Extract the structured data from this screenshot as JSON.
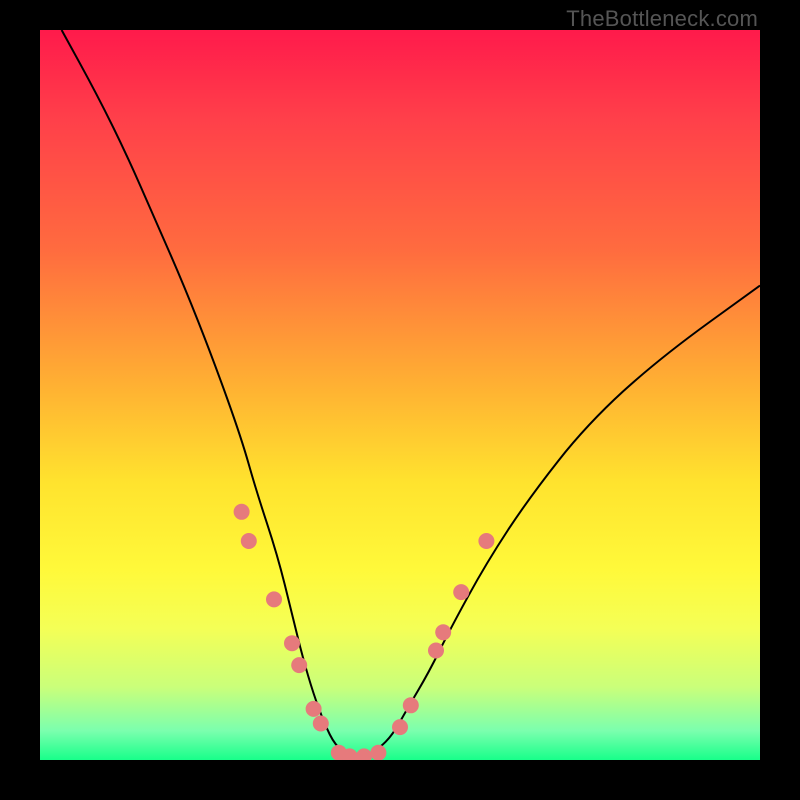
{
  "attribution": "TheBottleneck.com",
  "colors": {
    "gradient_top": "#ff1a4b",
    "gradient_bottom": "#18ff8a",
    "curve": "#000000",
    "dot": "#e67a7c",
    "frame": "#000000"
  },
  "chart_data": {
    "type": "line",
    "title": "",
    "xlabel": "",
    "ylabel": "",
    "xlim": [
      0,
      100
    ],
    "ylim": [
      0,
      100
    ],
    "legend": false,
    "grid": false,
    "series": [
      {
        "name": "bottleneck-curve",
        "x": [
          3,
          8,
          12,
          16,
          20,
          24,
          28,
          30,
          33,
          35,
          36.5,
          38,
          39.5,
          41,
          43,
          45,
          47,
          49,
          51,
          54,
          57,
          62,
          68,
          76,
          86,
          100
        ],
        "y": [
          100,
          91,
          83,
          74,
          65,
          55,
          44,
          37,
          28,
          20,
          14,
          9,
          5,
          2,
          0.5,
          0.5,
          1.5,
          3.5,
          7,
          12,
          18,
          27,
          36,
          46,
          55,
          65
        ]
      }
    ],
    "markers": [
      {
        "name": "dots-left",
        "x": 28,
        "y": 34
      },
      {
        "name": "dots-left",
        "x": 29,
        "y": 30
      },
      {
        "name": "dots-left",
        "x": 32.5,
        "y": 22
      },
      {
        "name": "dots-left",
        "x": 35,
        "y": 16
      },
      {
        "name": "dots-left",
        "x": 36,
        "y": 13
      },
      {
        "name": "dots-left",
        "x": 38,
        "y": 7
      },
      {
        "name": "dots-left",
        "x": 39,
        "y": 5
      },
      {
        "name": "dots-bottom",
        "x": 41.5,
        "y": 1
      },
      {
        "name": "dots-bottom",
        "x": 43,
        "y": 0.5
      },
      {
        "name": "dots-bottom",
        "x": 45,
        "y": 0.5
      },
      {
        "name": "dots-bottom",
        "x": 47,
        "y": 1
      },
      {
        "name": "dots-right",
        "x": 50,
        "y": 4.5
      },
      {
        "name": "dots-right",
        "x": 51.5,
        "y": 7.5
      },
      {
        "name": "dots-right",
        "x": 55,
        "y": 15
      },
      {
        "name": "dots-right",
        "x": 56,
        "y": 17.5
      },
      {
        "name": "dots-right",
        "x": 58.5,
        "y": 23
      },
      {
        "name": "dots-right",
        "x": 62,
        "y": 30
      }
    ]
  }
}
